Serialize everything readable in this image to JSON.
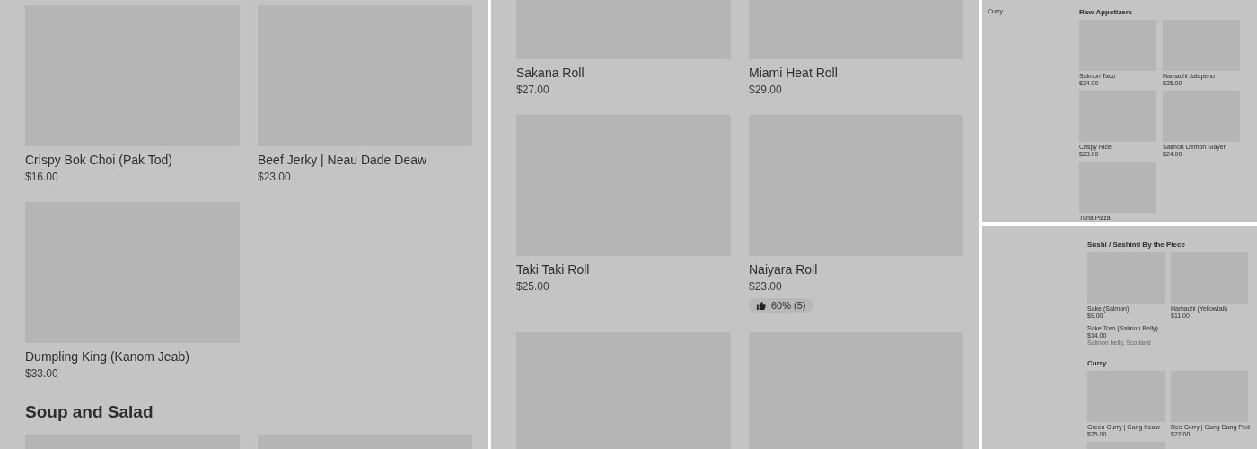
{
  "panels": [
    {
      "sections": [
        {
          "items": [
            {
              "kind": "dish",
              "name": "Crispy Bok Choi (Pak Tod)",
              "price": "$16.00"
            },
            {
              "kind": "dish",
              "name": "Beef Jerky | Neau Dade Deaw",
              "price": "$23.00"
            },
            {
              "kind": "dish",
              "name": "Dumpling King (Kanom Jeab)",
              "price": "$33.00"
            }
          ]
        },
        {
          "heading": "Soup and Salad",
          "items": [
            {
              "kind": "dish"
            },
            {
              "kind": "dish"
            }
          ]
        }
      ]
    },
    {
      "sections": [
        {
          "items": [
            {
              "kind": "dish",
              "name": "Sakana Roll",
              "price": "$27.00"
            },
            {
              "kind": "dish",
              "name": "Miami Heat Roll",
              "price": "$29.00"
            },
            {
              "kind": "dish",
              "name": "Taki Taki Roll",
              "price": "$25.00"
            },
            {
              "kind": "dish",
              "name": "Naiyara Roll",
              "price": "$23.00",
              "rating": "60% (5)"
            },
            {
              "kind": "dish"
            },
            {
              "kind": "dish"
            }
          ]
        }
      ]
    },
    {
      "sidebar": [
        "Curry"
      ],
      "sections": [
        {
          "heading": "Raw Appetizers",
          "items": [
            {
              "kind": "dish",
              "name": "Salmon Taco",
              "price": "$24.00"
            },
            {
              "kind": "dish",
              "name": "Hamachi Jalapeno",
              "price": "$25.00"
            },
            {
              "kind": "dish",
              "name": "Crispy Rice",
              "price": "$23.00"
            },
            {
              "kind": "dish",
              "name": "Salmon Demon Slayer",
              "price": "$24.00"
            },
            {
              "kind": "dish",
              "name": "Tuna Pizza"
            }
          ]
        }
      ]
    },
    {
      "sections": [
        {
          "heading": "Sushi / Sashimi By the Piece",
          "items": [
            {
              "kind": "dish",
              "name": "Sake (Salmon)",
              "price": "$9.00"
            },
            {
              "kind": "dish",
              "name": "Hamachi (Yellowtail)",
              "price": "$11.00"
            },
            {
              "kind": "text",
              "name": "Sake Toro (Salmon Belly)",
              "price": "$14.00",
              "description": "Salmon belly, Scotland"
            }
          ]
        },
        {
          "heading": "Curry",
          "items": [
            {
              "kind": "dish",
              "name": "Green Curry | Gang Keaw",
              "price": "$25.00"
            },
            {
              "kind": "dish",
              "name": "Red Curry | Gang Dang Ped",
              "price": "$22.00"
            },
            {
              "kind": "dish"
            }
          ]
        }
      ]
    }
  ]
}
